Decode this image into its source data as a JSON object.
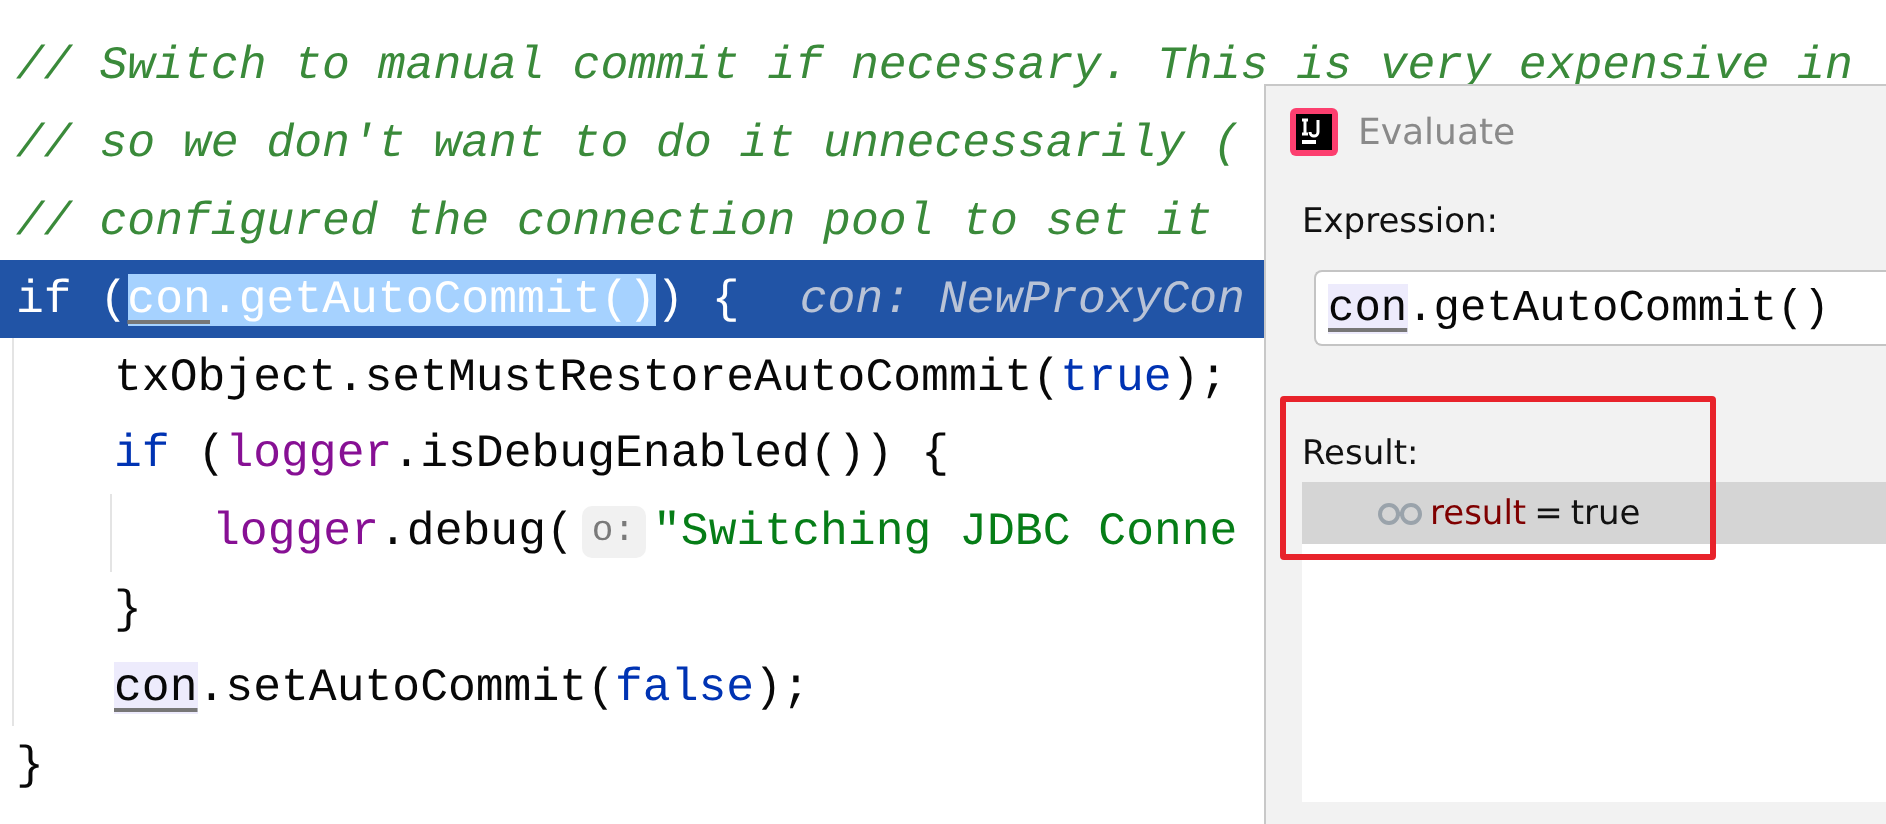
{
  "editor": {
    "lines": [
      {
        "current": false,
        "tokens": [
          {
            "text": "// Switch to manual commit if necessary. This is very expensive in",
            "kind": "comment"
          }
        ]
      },
      {
        "current": false,
        "tokens": [
          {
            "text": "// so we don't want to do it unnecessarily (",
            "kind": "comment"
          }
        ]
      },
      {
        "current": false,
        "tokens": [
          {
            "text": "// configured the connection pool to set it",
            "kind": "comment"
          }
        ]
      },
      {
        "current": true,
        "tokens": [
          {
            "text": "if (",
            "kind": "keyword"
          },
          {
            "text": "con",
            "kind": "selection-ref"
          },
          {
            "text": ".getAutoCommit()",
            "kind": "selection"
          },
          {
            "text": ") {",
            "kind": "plain"
          },
          {
            "text": "con: NewProxyCon",
            "kind": "inline-value"
          }
        ],
        "children": [
          {
            "current": false,
            "tokens": [
              {
                "text": "txObject.setMustRestoreAutoCommit(",
                "kind": "plain"
              },
              {
                "text": "true",
                "kind": "keyword"
              },
              {
                "text": ");",
                "kind": "plain"
              }
            ]
          },
          {
            "current": false,
            "tokens": [
              {
                "text": "if",
                "kind": "keyword"
              },
              {
                "text": " (",
                "kind": "plain"
              },
              {
                "text": "logger",
                "kind": "field"
              },
              {
                "text": ".isDebugEnabled()) {",
                "kind": "plain"
              }
            ],
            "children": [
              {
                "current": false,
                "tokens": [
                  {
                    "text": "logger",
                    "kind": "field"
                  },
                  {
                    "text": ".debug(",
                    "kind": "plain"
                  },
                  {
                    "text": "o:",
                    "kind": "param-hint"
                  },
                  {
                    "text": "\"Switching JDBC Conne",
                    "kind": "string"
                  }
                ]
              }
            ]
          },
          {
            "current": false,
            "tokens": [
              {
                "text": "}",
                "kind": "plain"
              }
            ]
          },
          {
            "current": false,
            "tokens": [
              {
                "text": "con",
                "kind": "ref"
              },
              {
                "text": ".setAutoCommit(",
                "kind": "plain"
              },
              {
                "text": "false",
                "kind": "keyword"
              },
              {
                "text": ");",
                "kind": "plain"
              }
            ]
          }
        ]
      },
      {
        "current": false,
        "tokens": [
          {
            "text": "}",
            "kind": "plain"
          }
        ]
      }
    ]
  },
  "dialog": {
    "title": "Evaluate",
    "expression_label": "Expression:",
    "expression": [
      {
        "text": "con",
        "kind": "ref"
      },
      {
        "text": ".getAutoCommit()",
        "kind": "plain"
      }
    ],
    "result_label": "Result:",
    "result": {
      "name": "result",
      "separator": "=",
      "value": "true",
      "selected": true
    },
    "highlight_box": true
  }
}
